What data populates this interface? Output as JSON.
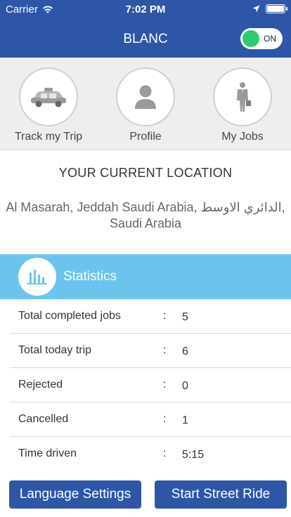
{
  "status_bar": {
    "carrier": "Carrier",
    "time": "7:02 PM"
  },
  "header": {
    "title": "BLANC",
    "toggle_label": "ON"
  },
  "shortcuts": [
    {
      "label": "Track my Trip",
      "icon": "taxi-icon"
    },
    {
      "label": "Profile",
      "icon": "user-icon"
    },
    {
      "label": "My Jobs",
      "icon": "briefcase-man-icon"
    }
  ],
  "location": {
    "heading": "YOUR CURRENT LOCATION",
    "address": "Al Masarah, Jeddah Saudi Arabia, الدائري الاوسط, Saudi Arabia"
  },
  "statistics": {
    "title": "Statistics",
    "rows": [
      {
        "label": "Total completed jobs",
        "value": "5"
      },
      {
        "label": "Total today trip",
        "value": "6"
      },
      {
        "label": "Rejected",
        "value": "0"
      },
      {
        "label": "Cancelled",
        "value": "1"
      },
      {
        "label": "Time driven",
        "value": "5:15"
      }
    ]
  },
  "buttons": {
    "language": "Language Settings",
    "street_ride": "Start Street Ride"
  },
  "colors": {
    "primary": "#2d56a7",
    "stats_header": "#6cc3ee",
    "toggle_on": "#2ecc71"
  }
}
